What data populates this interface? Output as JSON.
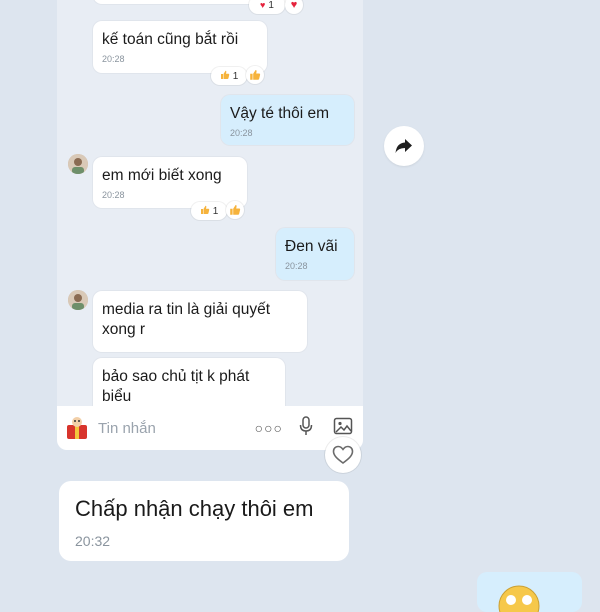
{
  "chat": {
    "messages": [
      {
        "text": "kế toán cũng bắt rồi",
        "time": "20:28",
        "reaction_count": "1"
      },
      {
        "text": "Vậy té thôi em",
        "time": "20:28"
      },
      {
        "text": "em mới biết xong",
        "time": "20:28",
        "reaction_count": "1"
      },
      {
        "text": "Đen vãi",
        "time": "20:28"
      },
      {
        "text": "media ra tin là giải quyết xong r"
      },
      {
        "text": "bảo sao chủ tịt k phát biểu"
      }
    ],
    "top_reaction_count": "1"
  },
  "composer": {
    "placeholder": "Tin nhắn"
  },
  "quoted_message": {
    "text": "Chấp nhận chạy thôi em",
    "time": "20:32"
  },
  "colors": {
    "incoming": "#ffffff",
    "outgoing": "#d6eefd",
    "background": "#dde5ef"
  },
  "icons": [
    "heart-icon",
    "thumbs-up-icon",
    "forward-icon",
    "more-icon",
    "microphone-icon",
    "image-icon",
    "sticker-icon",
    "emoji-icon"
  ]
}
